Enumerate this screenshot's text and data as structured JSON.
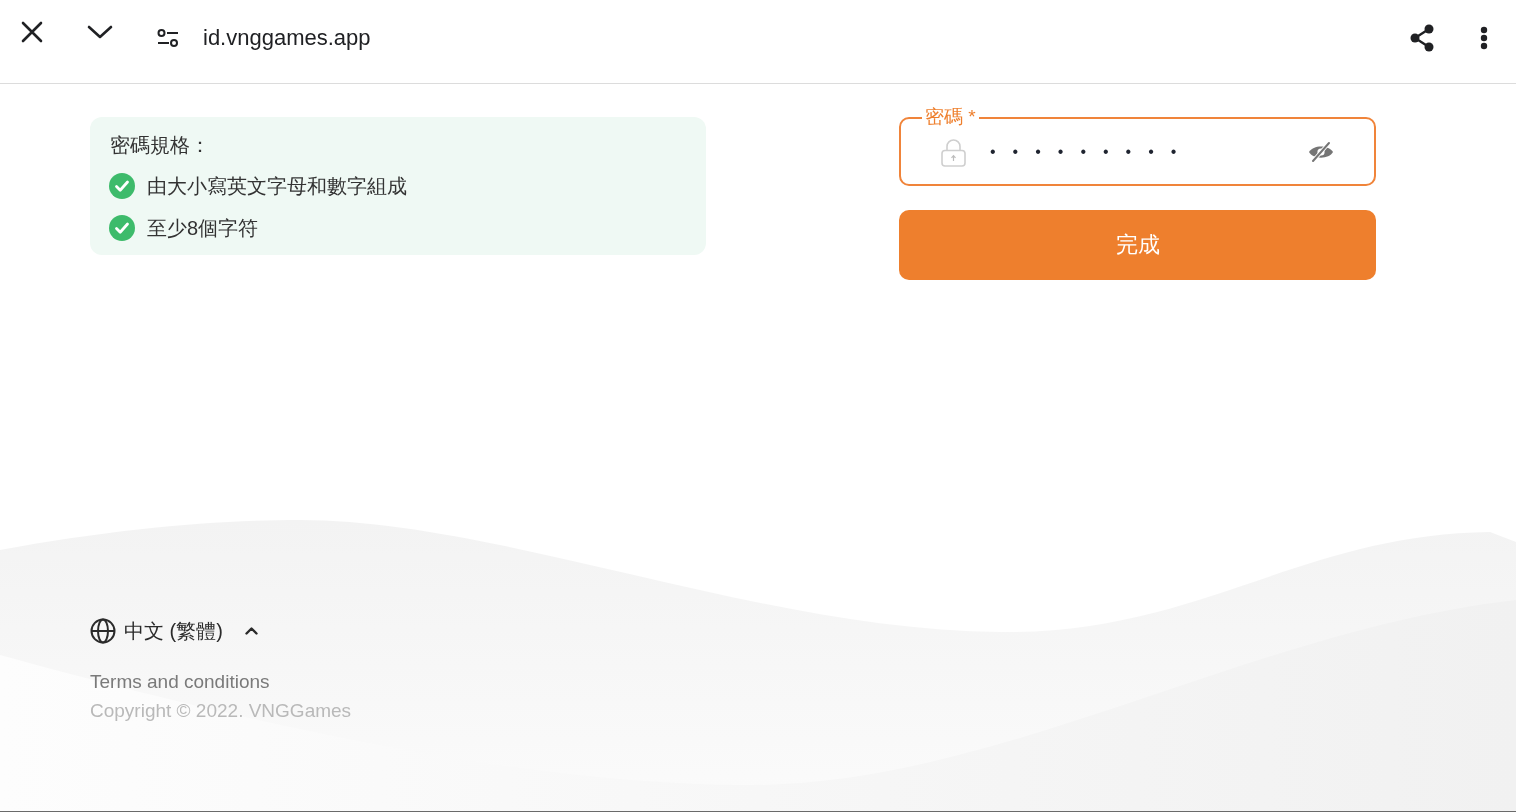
{
  "browser_bar": {
    "url": "id.vnggames.app"
  },
  "password_rules": {
    "title": "密碼規格：",
    "rules": [
      {
        "text": "由大小寫英文字母和數字組成",
        "met": true
      },
      {
        "text": "至少8個字符",
        "met": true
      }
    ]
  },
  "password_field": {
    "label": "密碼 *",
    "value": "•••••••••",
    "password_visible": false
  },
  "submit_button": {
    "label": "完成"
  },
  "footer": {
    "language": "中文 (繁體)",
    "terms_link": "Terms and conditions",
    "copyright": "Copyright © 2022. VNGGames"
  }
}
